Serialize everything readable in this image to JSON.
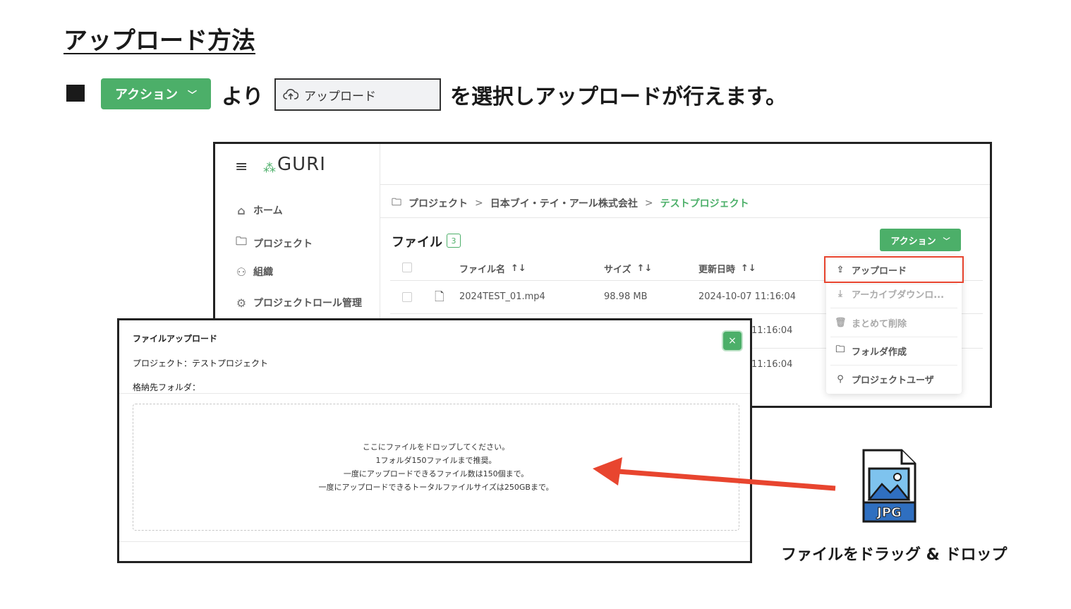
{
  "heading": "アップロード方法",
  "instruction": {
    "action_button": "アクション",
    "between_text": "より",
    "upload_option": "アップロード",
    "suffix_text": "を選択しアップロードが行えます。"
  },
  "app": {
    "logo": "GURI",
    "sidebar": {
      "items": [
        {
          "label": "ホーム"
        },
        {
          "label": "プロジェクト"
        },
        {
          "label": "組織"
        },
        {
          "label": "プロジェクトロール管理"
        }
      ]
    },
    "breadcrumb": {
      "root": "プロジェクト",
      "org": "日本ブイ・テイ・アール株式会社",
      "current": "テストプロジェクト",
      "separator": ">"
    },
    "files": {
      "title": "ファイル",
      "count": "3",
      "action_label": "アクション",
      "columns": {
        "name": "ファイル名",
        "size": "サイズ",
        "updated": "更新日時",
        "sort_icon": "↑↓"
      },
      "rows": [
        {
          "name": "2024TEST_01.mp4",
          "size": "98.98 MB",
          "updated": "2024-10-07 11:16:04"
        },
        {
          "updated": "11:16:04"
        },
        {
          "updated": "11:16:04"
        }
      ]
    },
    "menu": {
      "items": [
        {
          "label": "アップロード",
          "icon": "cloud-upload-icon"
        },
        {
          "label": "アーカイブダウンロ...",
          "icon": "archive-download-icon"
        },
        {
          "label": "まとめて削除",
          "icon": "trash-icon"
        },
        {
          "label": "フォルダ作成",
          "icon": "folder-plus-icon"
        },
        {
          "label": "プロジェクトユーザ",
          "icon": "user-plus-icon"
        }
      ]
    }
  },
  "modal": {
    "title": "ファイルアップロード",
    "project_line": "プロジェクト：テストプロジェクト",
    "folder_line": "格納先フォルダ：",
    "close_symbol": "×",
    "dropzone_lines": [
      "ここにファイルをドロップしてください。",
      "1フォルダ150ファイルまで推奨。",
      "一度にアップロードできるファイル数は150個まで。",
      "一度にアップロードできるトータルファイルサイズは250GBまで。"
    ]
  },
  "illustration": {
    "file_type": "JPG",
    "caption": "ファイルをドラッグ & ドロップ"
  },
  "colors": {
    "accent_green": "#4caf69",
    "highlight_red": "#e8452f",
    "jpg_blue": "#2f6fc0"
  }
}
